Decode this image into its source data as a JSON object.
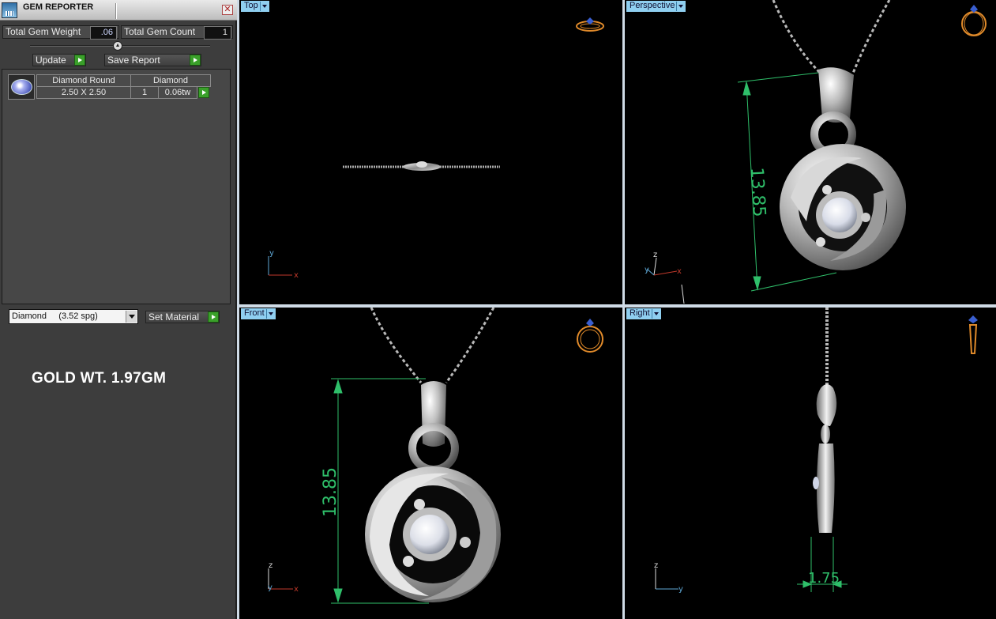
{
  "panel": {
    "title": "GEM REPORTER",
    "close_glyph": "✕",
    "total_gem_weight_label": "Total Gem Weight",
    "total_gem_weight_value": ".06",
    "total_gem_count_label": "Total Gem Count",
    "total_gem_count_value": "1",
    "update_label": "Update",
    "save_report_label": "Save Report",
    "gems": [
      {
        "icon": "round-diamond-icon",
        "name": "Diamond Round",
        "size": "2.50 X 2.50",
        "material": "Diamond",
        "count": "1",
        "weight": "0.06tw"
      }
    ],
    "material_select": "Diamond     (3.52 spg)",
    "set_material_label": "Set Material",
    "gold_weight": "GOLD WT. 1.97GM"
  },
  "viewports": {
    "top": {
      "label": "Top",
      "axes": [
        "y",
        "x"
      ]
    },
    "perspective": {
      "label": "Perspective",
      "dimension": "13.85",
      "axes": [
        "z",
        "y",
        "x"
      ]
    },
    "front": {
      "label": "Front",
      "dimension": "13.85",
      "axes": [
        "z",
        "y",
        "x"
      ]
    },
    "right": {
      "label": "Right",
      "dimension": "1.75",
      "axes": [
        "z",
        "y"
      ]
    }
  },
  "colors": {
    "viewport_label_bg": "#8fcff0",
    "dimension_line": "#2fbf6a",
    "go_arrow": "#3aa02a",
    "axis_x": "#c0392b",
    "axis_y": "#5fa8d6"
  }
}
